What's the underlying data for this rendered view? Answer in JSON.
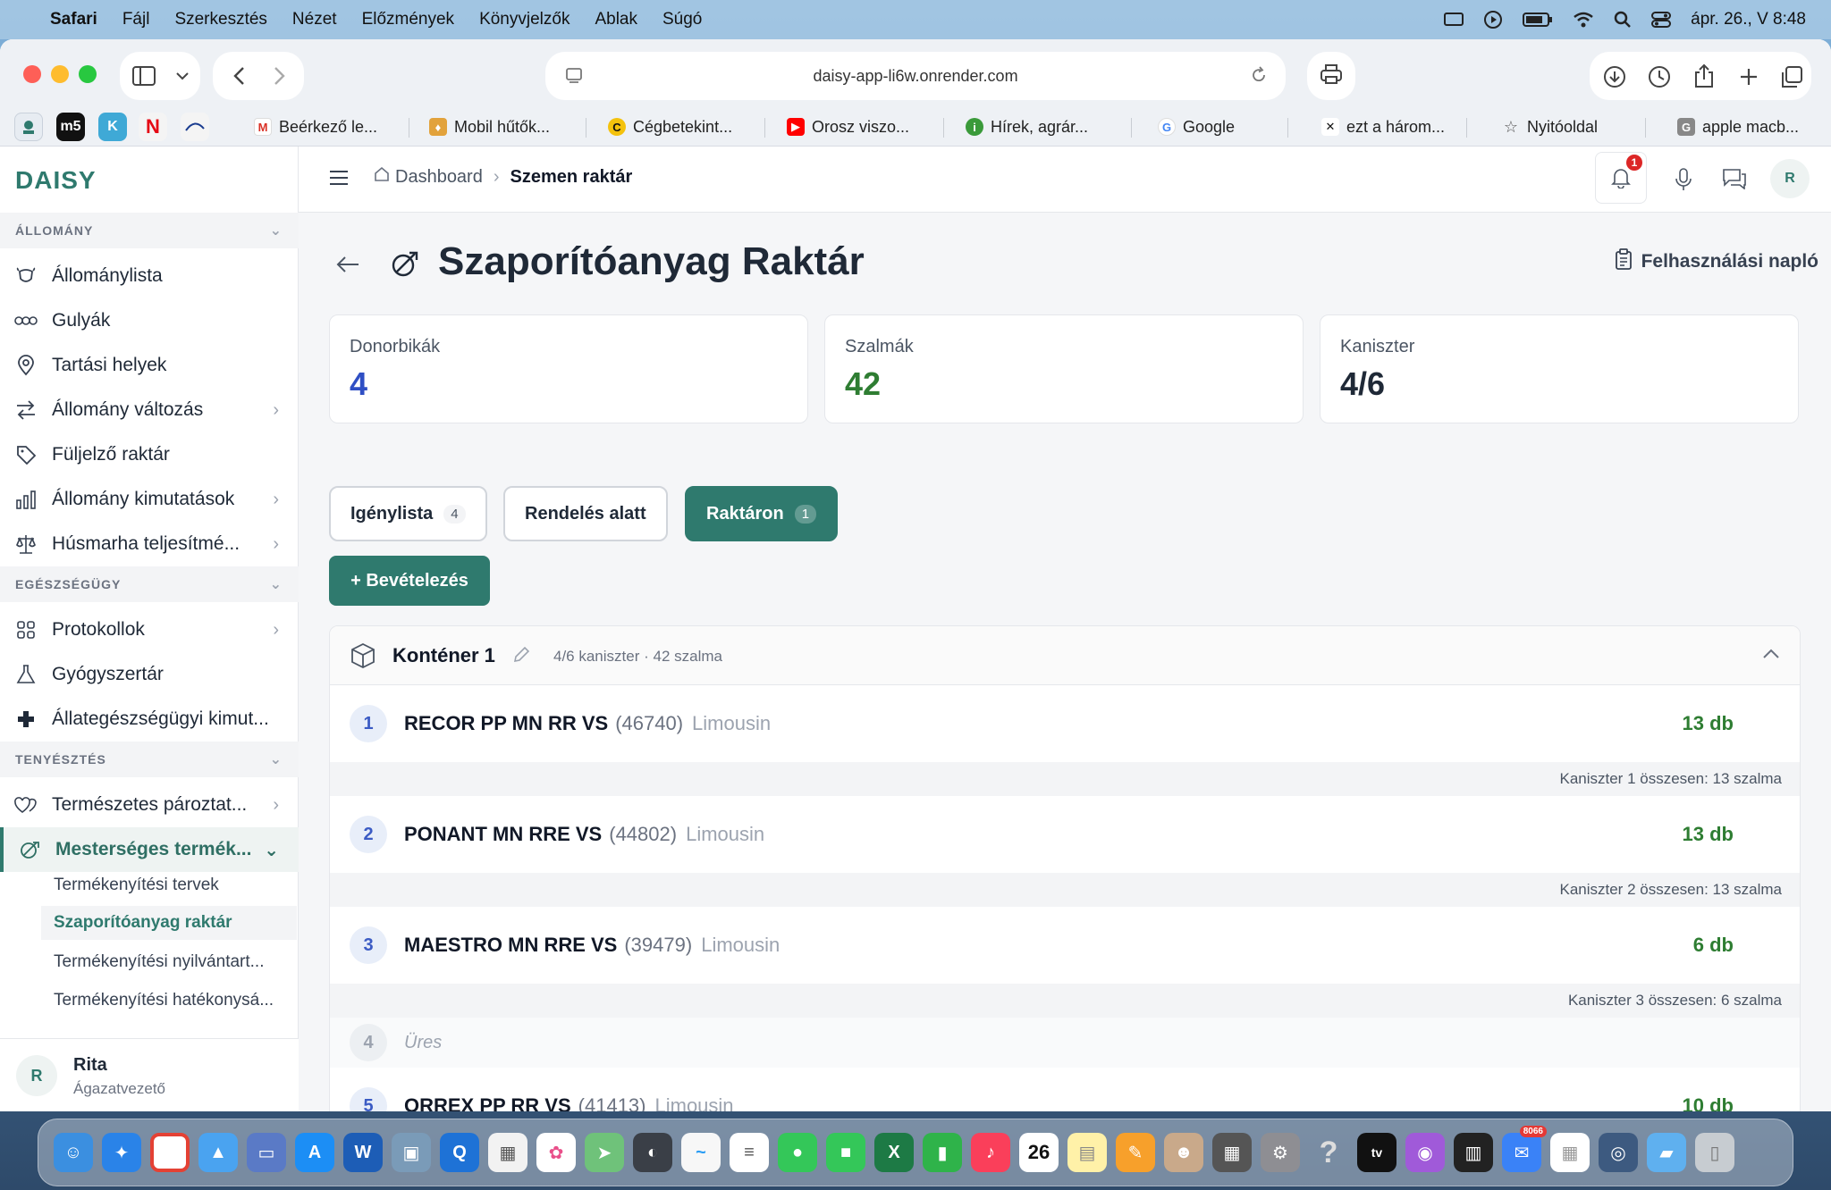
{
  "menubar": {
    "app": "Safari",
    "items": [
      "Fájl",
      "Szerkesztés",
      "Nézet",
      "Előzmények",
      "Könyvjelzők",
      "Ablak",
      "Súgó"
    ],
    "datetime": "ápr. 26., V  8:48"
  },
  "browser": {
    "url": "daisy-app-li6w.onrender.com",
    "bookmarks": [
      "Beérkező le...",
      "Mobil hűtők...",
      "Cégbetekint...",
      "Orosz viszo...",
      "Hírek, agrár...",
      "Google",
      "ezt a három...",
      "Nyitóoldal",
      "apple macb..."
    ]
  },
  "sidebar": {
    "logo": "DAISY",
    "sections": [
      {
        "title": "ÁLLOMÁNY"
      },
      {
        "title": "EGÉSZSÉGÜGY"
      },
      {
        "title": "TENYÉSZTÉS"
      }
    ],
    "items": [
      {
        "label": "Állománylista"
      },
      {
        "label": "Gulyák"
      },
      {
        "label": "Tartási helyek"
      },
      {
        "label": "Állomány változás"
      },
      {
        "label": "Füljelző raktár"
      },
      {
        "label": "Állomány kimutatások"
      },
      {
        "label": "Húsmarha teljesítmé..."
      },
      {
        "label": "Protokollok"
      },
      {
        "label": "Gyógyszertár"
      },
      {
        "label": "Állategészségügyi kimut..."
      },
      {
        "label": "Természetes pároztat..."
      },
      {
        "label": "Mesterséges termék..."
      }
    ],
    "subitems": [
      {
        "label": "Termékenyítési tervek"
      },
      {
        "label": "Szaporítóanyag raktár"
      },
      {
        "label": "Termékenyítési nyilvántart..."
      },
      {
        "label": "Termékenyítési hatékonysá..."
      }
    ],
    "user": {
      "initial": "R",
      "name": "Rita",
      "role": "Ágazatvezető"
    }
  },
  "topbar": {
    "breadcrumb_home": "Dashboard",
    "breadcrumb_current": "Szemen raktár",
    "notification_count": "1",
    "avatar_initial": "R"
  },
  "page": {
    "title": "Szaporítóanyag Raktár",
    "log_link": "Felhasználási napló",
    "cards": [
      {
        "label": "Donorbikák",
        "value": "4",
        "color": "#2f4fc4"
      },
      {
        "label": "Szalmák",
        "value": "42",
        "color": "#2e7d32"
      },
      {
        "label": "Kaniszter",
        "value": "4/6",
        "color": "#1f2937"
      }
    ],
    "tabs": [
      {
        "label": "Igénylista",
        "count": "4"
      },
      {
        "label": "Rendelés alatt",
        "count": ""
      },
      {
        "label": "Raktáron",
        "count": "1"
      }
    ],
    "add_button": "+ Bevételezés",
    "container": {
      "title": "Konténer 1",
      "meta": "4/6 kaniszter · 42 szalma",
      "rows": [
        {
          "num": "1",
          "name": "RECOR PP MN RR VS",
          "code": "(46740)",
          "breed": "Limousin",
          "qty": "13 db",
          "summary": "Kaniszter 1 összesen: 13 szalma"
        },
        {
          "num": "2",
          "name": "PONANT MN RRE VS",
          "code": "(44802)",
          "breed": "Limousin",
          "qty": "13 db",
          "summary": "Kaniszter 2 összesen: 13 szalma"
        },
        {
          "num": "3",
          "name": "MAESTRO MN RRE VS",
          "code": "(39479)",
          "breed": "Limousin",
          "qty": "6 db",
          "summary": "Kaniszter 3 összesen: 6 szalma"
        },
        {
          "num": "4",
          "empty_label": "Üres"
        },
        {
          "num": "5",
          "name": "ORREX PP RR VS",
          "code": "(41413)",
          "breed": "Limousin",
          "qty": "10 db"
        }
      ]
    }
  },
  "dock": {
    "calendar_day": "26",
    "badge": "8066"
  }
}
